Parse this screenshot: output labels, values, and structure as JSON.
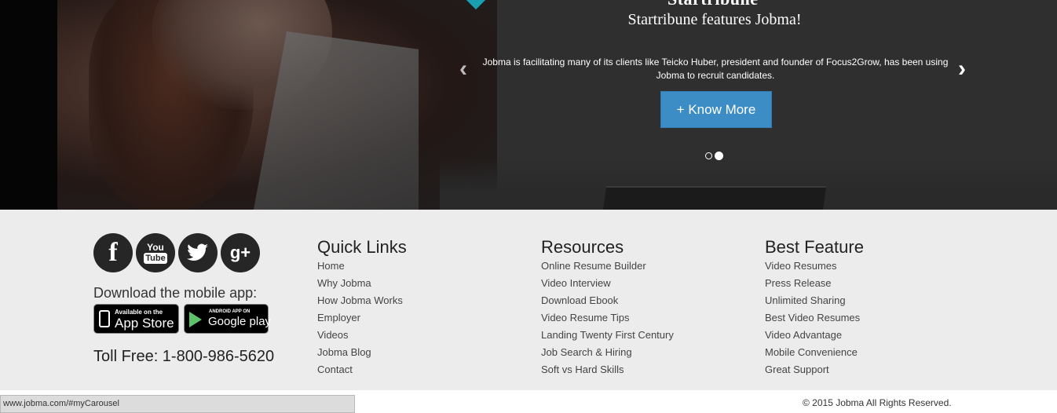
{
  "hero": {
    "heading_partial": "Startribune",
    "title": "Startribune features Jobma!",
    "text": "Jobma is facilitating many of its clients like Teicko Huber, president and founder of Focus2Grow, has been using Jobma to recruit candidates.",
    "prev_arrow": "‹",
    "next_arrow": "›",
    "button_label": "+ Know More",
    "slides": 2,
    "active_slide": 2,
    "accent_color": "#3c8dc5"
  },
  "footer": {
    "social_icons": [
      "facebook-icon",
      "youtube-icon",
      "twitter-icon",
      "google-plus-icon"
    ],
    "social_glyphs": {
      "facebook": "f",
      "youtube_top": "You",
      "youtube_bottom": "Tube",
      "twitter": "🐦",
      "googleplus": "g+"
    },
    "download_text": "Download the mobile app:",
    "app_store": {
      "small": "Available on the",
      "big": "App Store"
    },
    "google_play": {
      "small": "ANDROID APP ON",
      "big": "Google play"
    },
    "toll_free": "Toll Free: 1-800-986-5620",
    "quick_links": {
      "heading": "Quick Links",
      "items": [
        "Home",
        "Why Jobma",
        "How Jobma Works",
        "Employer",
        "Videos",
        "Jobma Blog",
        "Contact"
      ]
    },
    "resources": {
      "heading": "Resources",
      "items": [
        "Online Resume Builder",
        "Video Interview",
        "Download Ebook",
        "Video Resume Tips",
        "Landing Twenty First Century",
        "Job Search & Hiring",
        "Soft vs Hard Skills"
      ]
    },
    "best_feature": {
      "heading": "Best Feature",
      "items": [
        "Video Resumes",
        "Press Release",
        "Unlimited Sharing",
        "Best Video Resumes",
        "Video Advantage",
        "Mobile Convenience",
        "Great Support"
      ]
    },
    "copyright": "© 2015 Jobma All Rights Reserved."
  },
  "statusbar": {
    "url": "www.jobma.com/#myCarousel"
  }
}
